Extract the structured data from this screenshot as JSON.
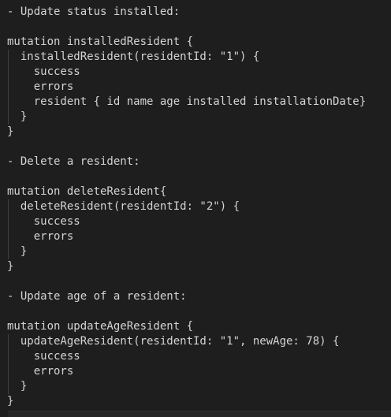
{
  "lines": [
    "- Update status installed:",
    "",
    "mutation installedResident {",
    "  installedResident(residentId: \"1\") {",
    "    success",
    "    errors",
    "    resident { id name age installed installationDate}",
    "  }",
    "}",
    "",
    "- Delete a resident:",
    "",
    "mutation deleteResident{",
    "  deleteResident(residentId: \"2\") {",
    "    success",
    "    errors",
    "  }",
    "}",
    "",
    "- Update age of a resident:",
    "",
    "mutation updateAgeResident {",
    "  updateAgeResident(residentId: \"1\", newAge: 78) {",
    "    success",
    "    errors",
    "  }",
    "}"
  ],
  "guides": [
    3,
    4,
    5,
    6,
    7,
    13,
    14,
    15,
    16,
    22,
    23,
    24,
    25
  ]
}
